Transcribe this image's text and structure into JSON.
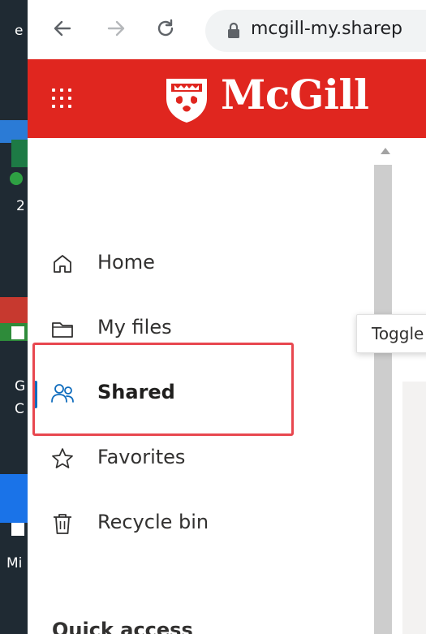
{
  "browser": {
    "url": "mcgill-my.sharep"
  },
  "header": {
    "brand": "McGill"
  },
  "nav": {
    "items": [
      {
        "label": "Home",
        "icon": "home-icon"
      },
      {
        "label": "My files",
        "icon": "folder-icon"
      },
      {
        "label": "Shared",
        "icon": "shared-people-icon",
        "active": true
      },
      {
        "label": "Favorites",
        "icon": "star-icon"
      },
      {
        "label": "Recycle bin",
        "icon": "trash-icon"
      }
    ],
    "section_heading": "Quick access"
  },
  "tooltip": {
    "text": "Toggle"
  },
  "desktop": {
    "fragments": [
      "e",
      "2",
      "G",
      "C",
      "Mi"
    ]
  },
  "colors": {
    "suite_header": "#e0261f",
    "active_indicator": "#0f6cbd",
    "highlight_box": "#e8474f"
  }
}
